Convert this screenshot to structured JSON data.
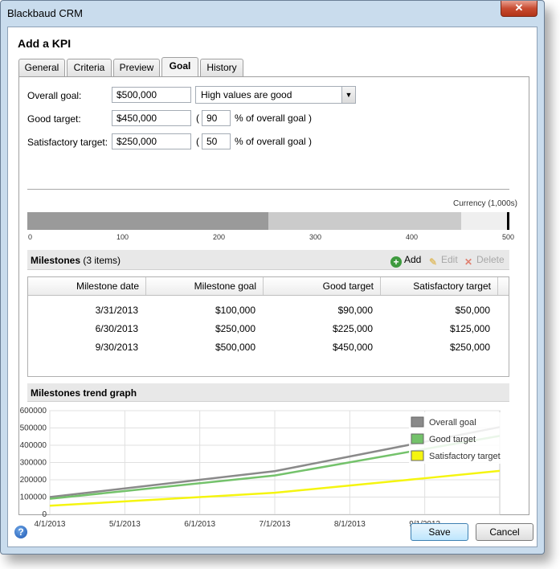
{
  "window": {
    "title": "Blackbaud CRM"
  },
  "dialog": {
    "title": "Add a KPI"
  },
  "tabs": [
    {
      "label": "General"
    },
    {
      "label": "Criteria"
    },
    {
      "label": "Preview"
    },
    {
      "label": "Goal",
      "active": true
    },
    {
      "label": "History"
    }
  ],
  "goal": {
    "overall_label": "Overall goal:",
    "overall_value": "$500,000",
    "direction_value": "High values are good",
    "good_label": "Good target:",
    "good_value": "$450,000",
    "good_percent": "90",
    "satisfactory_label": "Satisfactory target:",
    "satisfactory_value": "$250,000",
    "satisfactory_percent": "50",
    "open_paren": "(",
    "percent_suffix": "% of overall goal )"
  },
  "gauge": {
    "caption": "Currency (1,000s)",
    "min": 0,
    "max": 500,
    "satisfactory": 250,
    "good": 450,
    "goal": 500,
    "ticks": [
      "0",
      "100",
      "200",
      "300",
      "400",
      "500"
    ]
  },
  "milestones": {
    "title": "Milestones",
    "count": "(3 items)",
    "add_label": "Add",
    "edit_label": "Edit",
    "delete_label": "Delete",
    "columns": [
      "Milestone date",
      "Milestone goal",
      "Good target",
      "Satisfactory target"
    ],
    "rows": [
      [
        "3/31/2013",
        "$100,000",
        "$90,000",
        "$50,000"
      ],
      [
        "6/30/2013",
        "$250,000",
        "$225,000",
        "$125,000"
      ],
      [
        "9/30/2013",
        "$500,000",
        "$450,000",
        "$250,000"
      ]
    ]
  },
  "trend": {
    "title": "Milestones trend graph"
  },
  "chart_data": {
    "type": "line",
    "x": [
      "4/1/2013",
      "5/1/2013",
      "6/1/2013",
      "7/1/2013",
      "8/1/2013",
      "9/1/2013",
      "10/1/2013"
    ],
    "xticks": [
      "4/1/2013",
      "5/1/2013",
      "6/1/2013",
      "7/1/2013",
      "8/1/2013",
      "9/1/2013"
    ],
    "yticks": [
      "0",
      "100000",
      "200000",
      "300000",
      "400000",
      "500000",
      "600000"
    ],
    "ylim": [
      0,
      600000
    ],
    "series": [
      {
        "name": "Overall goal",
        "color": "#8a8a8a",
        "values": [
          100000,
          150000,
          200000,
          250000,
          335000,
          420000,
          505000
        ]
      },
      {
        "name": "Good target",
        "color": "#74c26b",
        "values": [
          90000,
          135000,
          180000,
          225000,
          301000,
          378000,
          454000
        ]
      },
      {
        "name": "Satisfactory target",
        "color": "#f5f510",
        "values": [
          50000,
          75000,
          100000,
          125000,
          167000,
          209000,
          252000
        ]
      }
    ],
    "grid": true,
    "legend": "top-right"
  },
  "footer": {
    "save_label": "Save",
    "cancel_label": "Cancel"
  },
  "colors": {
    "gauge_satisfactory": "#9a9a9a",
    "gauge_good": "#cbcbcb",
    "gauge_goal": "#000000"
  }
}
